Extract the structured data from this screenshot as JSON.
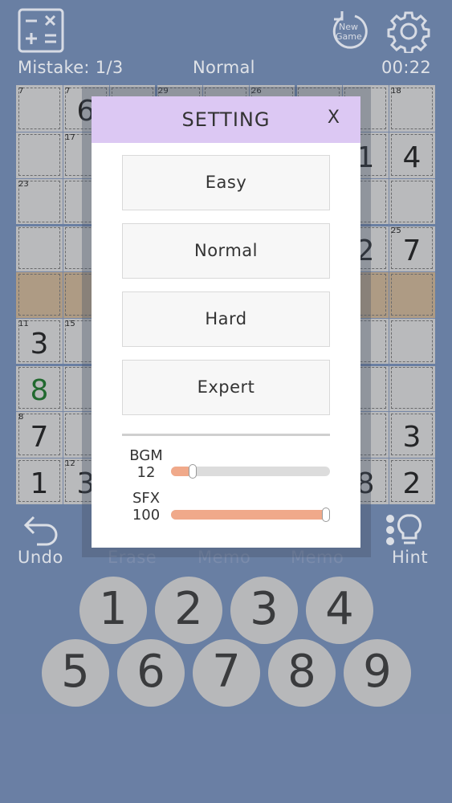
{
  "header": {
    "new_game_line1": "New",
    "new_game_line2": "Game",
    "mistake": "Mistake: 1/3",
    "difficulty": "Normal",
    "timer": "00:22"
  },
  "board": {
    "cells": [
      {
        "r": 0,
        "c": 0,
        "sum": "7",
        "val": ""
      },
      {
        "r": 0,
        "c": 1,
        "sum": "7",
        "val": "6"
      },
      {
        "r": 0,
        "c": 3,
        "sum": "29",
        "val": ""
      },
      {
        "r": 0,
        "c": 5,
        "sum": "26",
        "val": ""
      },
      {
        "r": 0,
        "c": 8,
        "sum": "18",
        "val": ""
      },
      {
        "r": 1,
        "c": 1,
        "sum": "17",
        "val": ""
      },
      {
        "r": 1,
        "c": 7,
        "sum": "",
        "val": "1"
      },
      {
        "r": 1,
        "c": 8,
        "sum": "",
        "val": "4"
      },
      {
        "r": 2,
        "c": 0,
        "sum": "23",
        "val": ""
      },
      {
        "r": 3,
        "c": 7,
        "sum": "",
        "val": "2"
      },
      {
        "r": 3,
        "c": 8,
        "sum": "25",
        "val": "7"
      },
      {
        "r": 5,
        "c": 0,
        "sum": "11",
        "val": "3"
      },
      {
        "r": 5,
        "c": 1,
        "sum": "15",
        "val": ""
      },
      {
        "r": 6,
        "c": 0,
        "sum": "",
        "val": "8",
        "user": true
      },
      {
        "r": 7,
        "c": 0,
        "sum": "8",
        "val": "7"
      },
      {
        "r": 7,
        "c": 8,
        "sum": "",
        "val": "3"
      },
      {
        "r": 8,
        "c": 0,
        "sum": "",
        "val": "1"
      },
      {
        "r": 8,
        "c": 1,
        "sum": "12",
        "val": "3"
      },
      {
        "r": 8,
        "c": 7,
        "sum": "",
        "val": "8"
      },
      {
        "r": 8,
        "c": 8,
        "sum": "",
        "val": "2"
      }
    ],
    "highlight_row": 4
  },
  "dialog": {
    "title": "SETTING",
    "close": "X",
    "levels": [
      "Easy",
      "Normal",
      "Hard",
      "Expert"
    ],
    "bgm_label": "BGM",
    "bgm_value": "12",
    "sfx_label": "SFX",
    "sfx_value": "100",
    "bgm_level": 0.12,
    "sfx_level": 1.0
  },
  "toolbar": {
    "undo": "Undo",
    "erase": "Erase",
    "memo1": "Memo",
    "memo2": "Memo",
    "hint": "Hint"
  },
  "numpad": [
    "1",
    "2",
    "3",
    "4",
    "5",
    "6",
    "7",
    "8",
    "9"
  ],
  "colors": {
    "background": "#6f86ac",
    "dialog_header": "#dcc8f3",
    "slider_fill": "#f0a98a",
    "user_digit": "#1f6e2b"
  }
}
